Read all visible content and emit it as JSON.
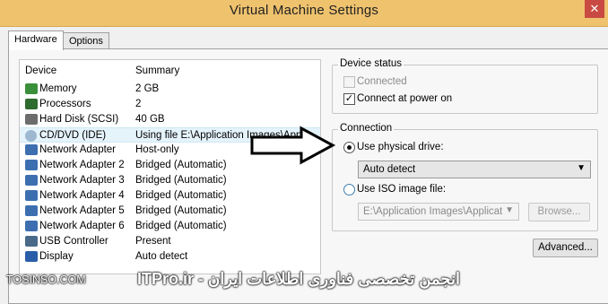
{
  "window": {
    "title": "Virtual Machine Settings",
    "close_glyph": "✕"
  },
  "tabs": [
    "Hardware",
    "Options"
  ],
  "device_list": {
    "col_device": "Device",
    "col_summary": "Summary",
    "rows": [
      {
        "name": "Memory",
        "summary": "2 GB",
        "icon": "memory-icon",
        "color": "#3a8f3a"
      },
      {
        "name": "Processors",
        "summary": "2",
        "icon": "processor-icon",
        "color": "#2e6b2e"
      },
      {
        "name": "Hard Disk (SCSI)",
        "summary": "40 GB",
        "icon": "hard-disk-icon",
        "color": "#6d6d6d"
      },
      {
        "name": "CD/DVD (IDE)",
        "summary": "Using file E:\\Application Images\\Appl...",
        "icon": "cd-dvd-icon",
        "color": "#9db8d0"
      },
      {
        "name": "Network Adapter",
        "summary": "Host-only",
        "icon": "network-adapter-icon",
        "color": "#3d6fb0"
      },
      {
        "name": "Network Adapter 2",
        "summary": "Bridged (Automatic)",
        "icon": "network-adapter-icon",
        "color": "#3d6fb0"
      },
      {
        "name": "Network Adapter 3",
        "summary": "Bridged (Automatic)",
        "icon": "network-adapter-icon",
        "color": "#3d6fb0"
      },
      {
        "name": "Network Adapter 4",
        "summary": "Bridged (Automatic)",
        "icon": "network-adapter-icon",
        "color": "#3d6fb0"
      },
      {
        "name": "Network Adapter 5",
        "summary": "Bridged (Automatic)",
        "icon": "network-adapter-icon",
        "color": "#3d6fb0"
      },
      {
        "name": "Network Adapter 6",
        "summary": "Bridged (Automatic)",
        "icon": "network-adapter-icon",
        "color": "#3d6fb0"
      },
      {
        "name": "USB Controller",
        "summary": "Present",
        "icon": "usb-icon",
        "color": "#4a6a8a"
      },
      {
        "name": "Display",
        "summary": "Auto detect",
        "icon": "display-icon",
        "color": "#2a5ea8"
      }
    ]
  },
  "device_status": {
    "legend": "Device status",
    "connected_label": "Connected",
    "connect_at_power_on_label": "Connect at power on"
  },
  "connection": {
    "legend": "Connection",
    "physical_label": "Use physical drive:",
    "physical_value": "Auto detect",
    "iso_label": "Use ISO image file:",
    "iso_value": "E:\\Application Images\\Applicatic",
    "browse_label": "Browse..."
  },
  "advanced_label": "Advanced...",
  "watermark": {
    "left": "TOSINSO.COM",
    "right": "انجمن تخصصی فناوری اطلاعات ایران - ITPro.ir"
  }
}
